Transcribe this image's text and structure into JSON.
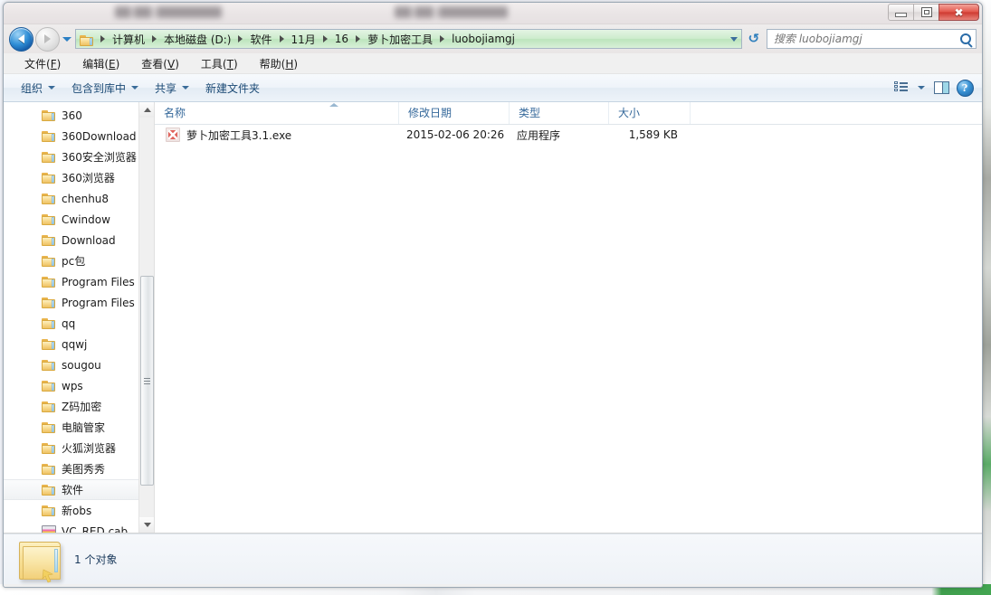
{
  "window": {
    "title_obscured": true,
    "controls": {
      "minimize": "—",
      "maximize": "□",
      "close": "✖"
    }
  },
  "navigation": {
    "back_label": "后退",
    "forward_label": "前进",
    "history_label": "最近的位置",
    "refresh_label": "刷新",
    "dropdown_label": "展开"
  },
  "address": {
    "crumbs": [
      "计算机",
      "本地磁盘 (D:)",
      "软件",
      "11月",
      "16",
      "萝卜加密工具",
      "luobojiamgj"
    ],
    "separator": "▸"
  },
  "search": {
    "placeholder": "搜索 luobojiamgj",
    "value": "",
    "icon": "search-icon"
  },
  "menubar": {
    "items": [
      {
        "text": "文件",
        "accel": "F"
      },
      {
        "text": "编辑",
        "accel": "E"
      },
      {
        "text": "查看",
        "accel": "V"
      },
      {
        "text": "工具",
        "accel": "T"
      },
      {
        "text": "帮助",
        "accel": "H"
      }
    ]
  },
  "commandbar": {
    "items": [
      {
        "label": "组织",
        "has_caret": true
      },
      {
        "label": "包含到库中",
        "has_caret": true
      },
      {
        "label": "共享",
        "has_caret": true
      },
      {
        "label": "新建文件夹",
        "has_caret": false
      }
    ],
    "view_button": "view-options-icon",
    "preview_button": "preview-pane-icon",
    "help_button": "?"
  },
  "navpane": {
    "items": [
      {
        "label": "360",
        "type": "folder",
        "selected": false
      },
      {
        "label": "360Download",
        "type": "folder",
        "selected": false
      },
      {
        "label": "360安全浏览器",
        "type": "folder",
        "selected": false
      },
      {
        "label": "360浏览器",
        "type": "folder",
        "selected": false
      },
      {
        "label": "chenhu8",
        "type": "folder",
        "selected": false
      },
      {
        "label": "Cwindow",
        "type": "folder",
        "selected": false
      },
      {
        "label": "Download",
        "type": "folder",
        "selected": false
      },
      {
        "label": "pc包",
        "type": "folder",
        "selected": false
      },
      {
        "label": "Program Files",
        "type": "folder",
        "selected": false
      },
      {
        "label": "Program Files",
        "type": "folder",
        "selected": false
      },
      {
        "label": "qq",
        "type": "folder",
        "selected": false
      },
      {
        "label": "qqwj",
        "type": "folder",
        "selected": false
      },
      {
        "label": "sougou",
        "type": "folder",
        "selected": false
      },
      {
        "label": "wps",
        "type": "folder",
        "selected": false
      },
      {
        "label": "Z码加密",
        "type": "folder",
        "selected": false
      },
      {
        "label": "电脑管家",
        "type": "folder",
        "selected": false
      },
      {
        "label": "火狐浏览器",
        "type": "folder",
        "selected": false
      },
      {
        "label": "美图秀秀",
        "type": "folder",
        "selected": false
      },
      {
        "label": "软件",
        "type": "folder",
        "selected": true
      },
      {
        "label": "新obs",
        "type": "folder",
        "selected": false
      },
      {
        "label": "VC_RED.cab",
        "type": "cab",
        "selected": false
      }
    ]
  },
  "filelist": {
    "columns": [
      {
        "key": "name",
        "label": "名称",
        "sorted": true
      },
      {
        "key": "date",
        "label": "修改日期",
        "sorted": false
      },
      {
        "key": "type",
        "label": "类型",
        "sorted": false
      },
      {
        "key": "size",
        "label": "大小",
        "sorted": false
      }
    ],
    "rows": [
      {
        "icon": "exe-icon",
        "name": "萝卜加密工具3.1.exe",
        "date": "2015-02-06 20:26",
        "type": "应用程序",
        "size": "1,589 KB"
      }
    ]
  },
  "statusbar": {
    "text": "1 个对象",
    "icon": "folder-icon-large"
  },
  "colors": {
    "accent_blue": "#36699b",
    "address_progress_green": "#cdeccd",
    "close_red": "#cf3b32",
    "folder_yellow": "#f7d98d"
  }
}
